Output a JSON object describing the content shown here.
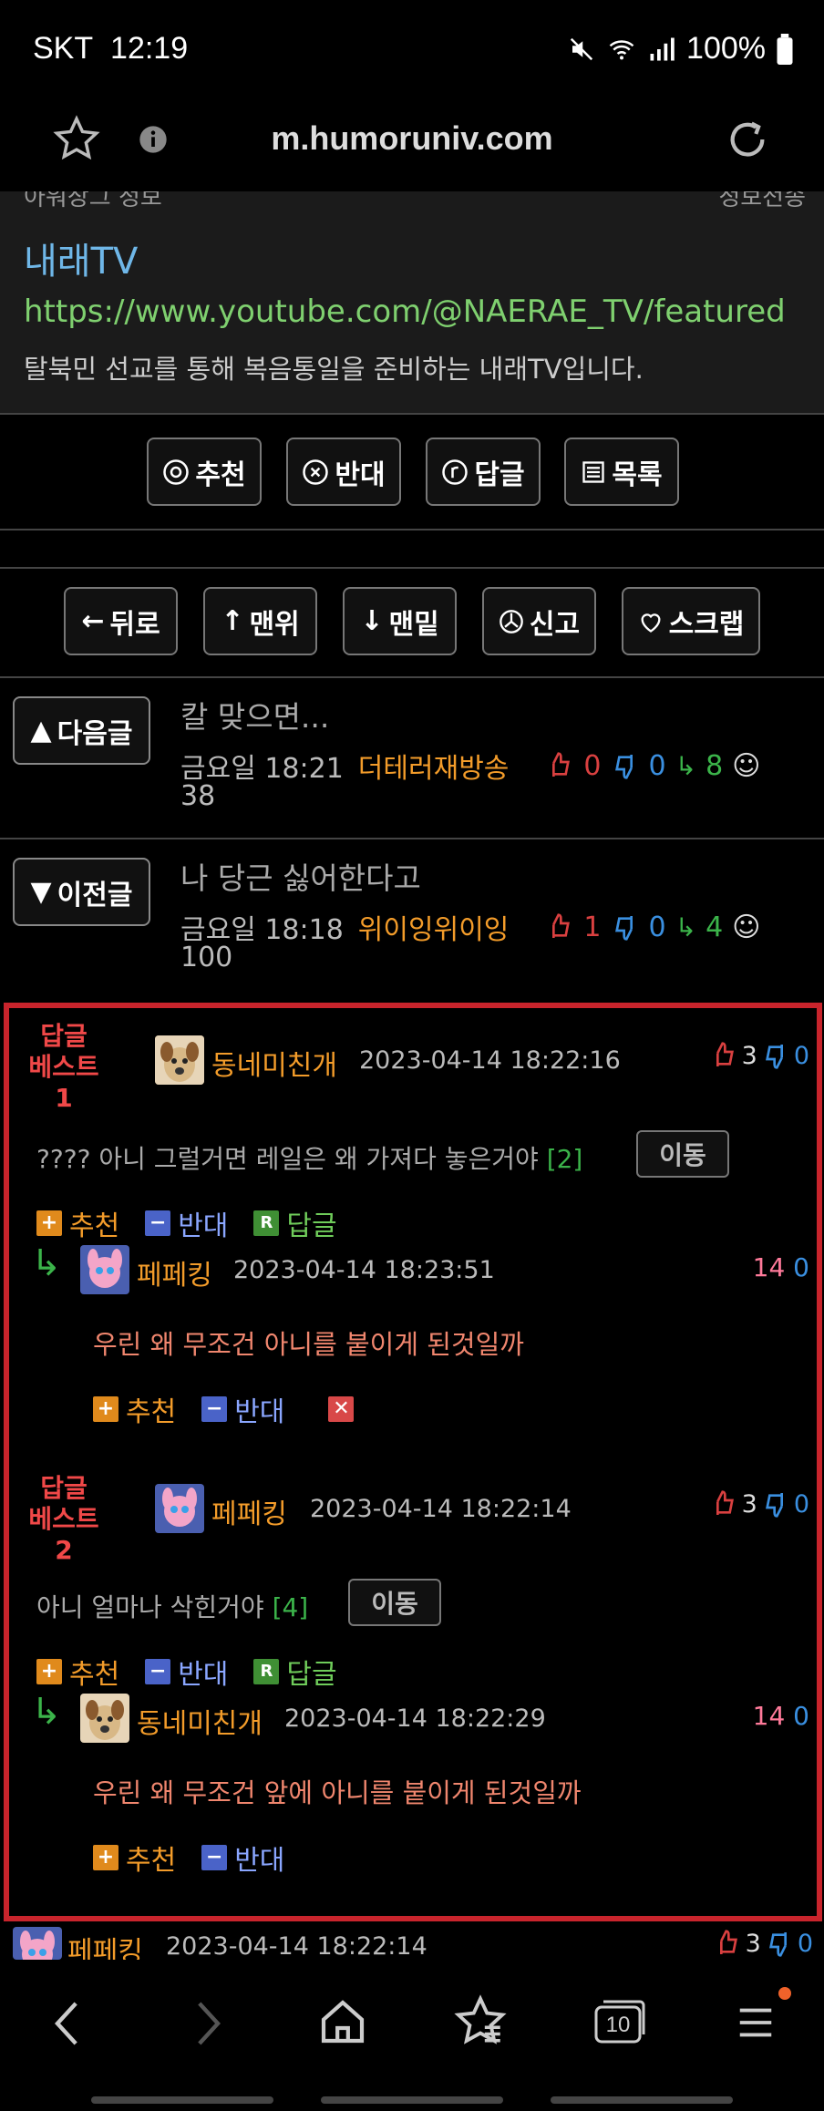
{
  "status": {
    "carrier": "SKT",
    "time": "12:19",
    "battery": "100%"
  },
  "browser": {
    "url": "m.humoruniv.com",
    "tab_count": "10"
  },
  "channel": {
    "partial_left": "아워장그 정보",
    "partial_right": "정보전송",
    "name": "내래TV",
    "link": "https://www.youtube.com/@NAERAE_TV/featured",
    "desc": "탈북민 선교를 통해 복음통일을 준비하는 내래TV입니다."
  },
  "actions": {
    "recommend": "추천",
    "oppose": "반대",
    "reply": "답글",
    "list": "목록"
  },
  "nav": {
    "back": "뒤로",
    "top": "맨위",
    "bottom": "맨밑",
    "report": "신고",
    "scrap": "스크랩"
  },
  "next": {
    "label": "다음글",
    "title": "칼 맞으면...",
    "date": "금요일 18:21",
    "author": "더테러재방송",
    "up": "0",
    "down": "0",
    "replies": "8",
    "views": "38"
  },
  "prev": {
    "label": "이전글",
    "title": "나 당근 싫어한다고",
    "date": "금요일 18:18",
    "author": "위이잉위이잉",
    "up": "1",
    "down": "0",
    "replies": "4",
    "views": "100"
  },
  "best": [
    {
      "badge1": "답글",
      "badge2": "베스트1",
      "author": "동네미친개",
      "date": "2023-04-14 18:22:16",
      "up": "3",
      "down": "0",
      "text": "???? 아니 그럴거면 레일은 왜 가져다 놓은거야",
      "count": "[2]",
      "move": "이동",
      "rec": "추천",
      "opp": "반대",
      "rep": "답글",
      "reply": {
        "author": "페페킹",
        "date": "2023-04-14 18:23:51",
        "up": "14",
        "down": "0",
        "text": "우린 왜 무조건 아니를 붙이게 된것일까",
        "rec": "추천",
        "opp": "반대"
      }
    },
    {
      "badge1": "답글",
      "badge2": "베스트2",
      "author": "페페킹",
      "date": "2023-04-14 18:22:14",
      "up": "3",
      "down": "0",
      "text": "아니 얼마나 삭힌거야",
      "count": "[4]",
      "move": "이동",
      "rec": "추천",
      "opp": "반대",
      "rep": "답글",
      "reply": {
        "author": "동네미친개",
        "date": "2023-04-14 18:22:29",
        "up": "14",
        "down": "0",
        "text": "우린 왜 무조건 앞에 아니를 붙이게 된것일까",
        "rec": "추천",
        "opp": "반대"
      }
    }
  ],
  "last": {
    "author": "페페킹",
    "date": "2023-04-14 18:22:14",
    "up": "3",
    "down": "0"
  },
  "colors": {
    "accent_red": "#c8242c",
    "author": "#f39c2a",
    "link": "#7fd06f",
    "channel_name": "#6fb7e8"
  }
}
